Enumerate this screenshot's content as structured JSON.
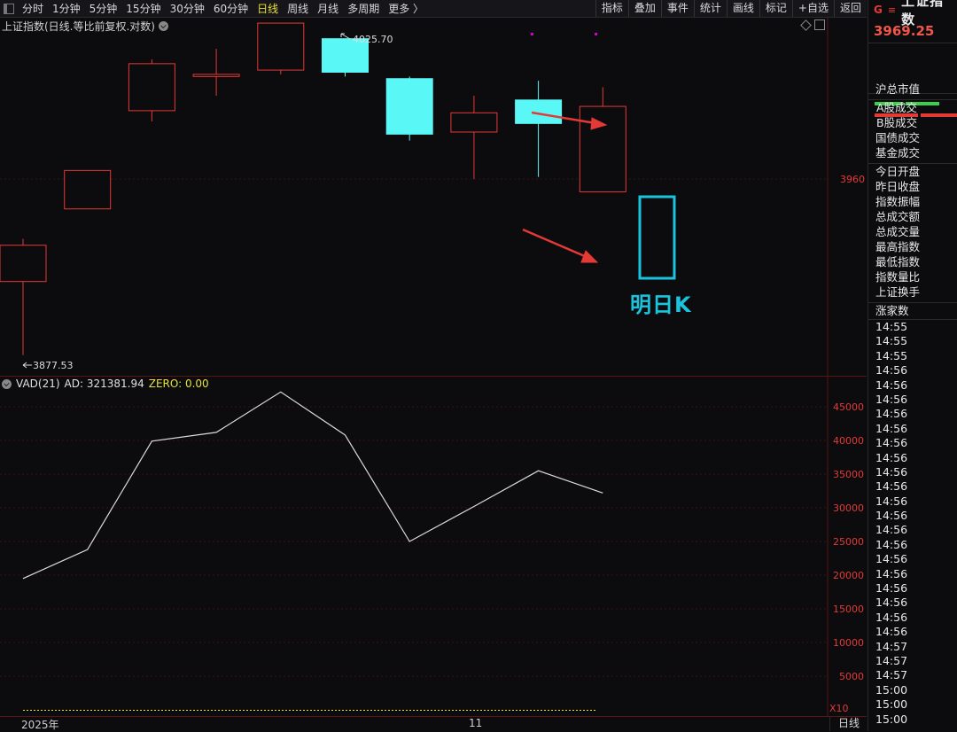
{
  "toolbar": {
    "periods": [
      "分时",
      "1分钟",
      "5分钟",
      "15分钟",
      "30分钟",
      "60分钟",
      "日线",
      "周线",
      "月线",
      "多周期",
      "更多 〉"
    ],
    "active_period": "日线",
    "tools": [
      "指标",
      "叠加",
      "事件",
      "统计",
      "画线",
      "标记",
      "+自选",
      "返回"
    ]
  },
  "chart": {
    "title": "上证指数(日线.等比前复权.对数)",
    "high_label": "4025.70",
    "low_label": "3877.53",
    "price_tick": "3960",
    "tomorrow_label": "明日K"
  },
  "indicator": {
    "name": "VAD(21)",
    "ad_label": "AD: 321381.94",
    "zero_label": "ZERO: 0.00",
    "multiplier": "X10"
  },
  "xaxis": {
    "year": "2025年",
    "month": "11",
    "period": "日线"
  },
  "sidebar": {
    "g": "G",
    "eq": "≡",
    "name": "上证指数",
    "price": "3969.25",
    "fields": [
      "沪总市值",
      "A股成交",
      "B股成交",
      "国债成交",
      "基金成交",
      "今日开盘",
      "昨日收盘",
      "指数振幅",
      "总成交额",
      "总成交量",
      "最高指数",
      "最低指数",
      "指数量比",
      "上证换手",
      "涨家数"
    ],
    "times": [
      "14:55",
      "14:55",
      "14:55",
      "14:56",
      "14:56",
      "14:56",
      "14:56",
      "14:56",
      "14:56",
      "14:56",
      "14:56",
      "14:56",
      "14:56",
      "14:56",
      "14:56",
      "14:56",
      "14:56",
      "14:56",
      "14:56",
      "14:56",
      "14:56",
      "14:56",
      "14:57",
      "14:57",
      "14:57",
      "15:00",
      "15:00",
      "15:00"
    ]
  },
  "colors": {
    "up": "#e53935",
    "down": "#5af7f7",
    "line": "#dcdcdc",
    "accent": "#19c4dc",
    "active": "#e8e03a"
  },
  "chart_data": [
    {
      "type": "candlestick",
      "title": "上证指数(日线.等比前复权.对数)",
      "candles": [
        {
          "o": 3912,
          "c": 3929,
          "h": 3932,
          "l": 3877.53,
          "dir": "up"
        },
        {
          "o": 3946,
          "c": 3964,
          "h": 3964,
          "l": 3946,
          "dir": "up"
        },
        {
          "o": 3992,
          "c": 4014,
          "h": 4016,
          "l": 3987,
          "dir": "up"
        },
        {
          "o": 4008,
          "c": 4009,
          "h": 4021,
          "l": 3999,
          "dir": "up"
        },
        {
          "o": 4011,
          "c": 4033,
          "h": 4033,
          "l": 4009,
          "dir": "up"
        },
        {
          "o": 4025.7,
          "c": 4010,
          "h": 4025.7,
          "l": 4008,
          "dir": "down"
        },
        {
          "o": 4007,
          "c": 3981,
          "h": 4008,
          "l": 3978,
          "dir": "down"
        },
        {
          "o": 3991,
          "c": 3982,
          "h": 3999,
          "l": 3960,
          "dir": "up"
        },
        {
          "o": 3997,
          "c": 3986,
          "h": 4006,
          "l": 3961,
          "dir": "down"
        },
        {
          "o": 3994,
          "c": 3954,
          "h": 4003,
          "l": 3954,
          "dir": "up"
        }
      ],
      "yticks": [
        3960
      ]
    },
    {
      "type": "line",
      "series": [
        {
          "name": "VAD(21)",
          "values": [
            19500,
            23800,
            39900,
            41200,
            47200,
            40800,
            25000,
            30200,
            35500,
            32200
          ]
        }
      ],
      "yticks": [
        5000,
        10000,
        15000,
        20000,
        25000,
        30000,
        35000,
        40000,
        45000
      ],
      "ylim": [
        0,
        50000
      ]
    }
  ]
}
